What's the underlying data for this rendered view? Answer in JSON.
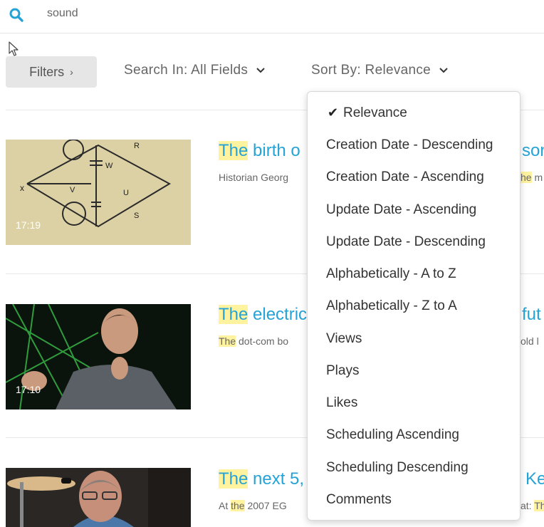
{
  "search": {
    "value": "sound"
  },
  "toolbar": {
    "filters_label": "Filters",
    "filters_chevron": "›",
    "search_in_label": "Search In: All Fields",
    "sort_by_label": "Sort By: Relevance",
    "caret": "⌄"
  },
  "results": [
    {
      "title_highlight": "The",
      "title_visible": " birth o",
      "title_tail": "sor",
      "desc_visible": "Historian Georg",
      "desc_tail_highlight": "he",
      "desc_tail": " m",
      "duration": "17:19"
    },
    {
      "title_highlight": "The",
      "title_visible": " electric",
      "title_tail": "fut",
      "desc_highlight": "The",
      "desc_visible": " dot-com bo",
      "desc_tail": "old l",
      "duration": "17:10"
    },
    {
      "title_highlight": "The",
      "title_visible": " next 5,",
      "title_tail": "Ke",
      "desc_prefix": "At ",
      "desc_highlight": "the",
      "desc_visible": " 2007 EG",
      "desc_tail": "at: ",
      "desc_tail_highlight": "Th"
    }
  ],
  "sort_menu": {
    "check_icon": "✔",
    "items": [
      "Relevance",
      "Creation Date - Descending",
      "Creation Date - Ascending",
      "Update Date - Ascending",
      "Update Date - Descending",
      "Alphabetically - A to Z",
      "Alphabetically - Z to A",
      "Views",
      "Plays",
      "Likes",
      "Scheduling Ascending",
      "Scheduling Descending",
      "Comments"
    ],
    "selected_index": 0
  },
  "colors": {
    "accent": "#26a3d6",
    "highlight": "#fff3a0"
  }
}
